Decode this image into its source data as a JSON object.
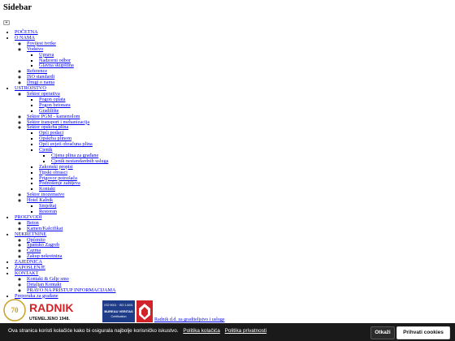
{
  "sidebar": {
    "title": "Sidebar",
    "toggle": "+"
  },
  "nav": {
    "pocetna": "POČETNA",
    "o_nama": {
      "label": "O NAMA",
      "povijest": "Povijest tvrtke",
      "vodstvo": "Vodstvo",
      "uprava": "Uprava",
      "nadzorni": "Nadzorni odbor",
      "glavna": "Glavna skupština",
      "reference": "Reference",
      "iso": "ISO standardi",
      "drugi": "Drugi o nama"
    },
    "ustrojstvo": {
      "label": "USTROJSTVO",
      "operativa": "Sektor operativa",
      "pogon_oplata": "Pogon oplata",
      "pogon_betonara": "Pogon betonara",
      "gradiliste": "Gradilište",
      "pgm": "Sektor PGM - kamenolom",
      "transport": "Sektor transport i mehanizacija",
      "opskrba": "Sektor opskrba plina",
      "opci_podaci": "Opći podaci",
      "opskrba_plinom": "Opskrba plinom",
      "opci_uvjeti": "Opći uvjeti obračuna plina",
      "cjenik": "Cjenik",
      "cijena_plina": "Cijena plina za građane",
      "cjenik_usluga": "Cjenik nestandardnih usluga",
      "zakonski": "Zakonski propisi",
      "tipski": "Tipski obrasci",
      "prigovor": "Prigovor potrošača",
      "podnosenje": "Podnošenje zahtjeva",
      "kontakt": "Kontakt",
      "inozemstvo": "Sektor inozemstvo",
      "hotel": "Hotel Kalnik",
      "smjestaj": "Smještaj",
      "restoran": "Restoran"
    },
    "proizvodi": {
      "label": "PROIZVODI",
      "beton": "Beton",
      "kamen": "Kamen/Kalcifikat"
    },
    "nekretnine": {
      "label": "NEKRETNINE",
      "openito": "Općenito",
      "spansko": "Špansko Zagreb",
      "cazma": "Čazma",
      "zakup": "Zakup nekretnina"
    },
    "zajednica": "ZAJEDNICA",
    "zaposlenje": "ZAPOSLENJE",
    "kontakt": {
      "label": "KONTAKT",
      "kontakt_gdje": "Kontakt & Gdje smo",
      "detaljan": "Detaljan Kontakt",
      "pravo": "PRAVO NA PRISTUP INFORMACIJAMA"
    },
    "preporuka": "Preporuka za građane"
  },
  "logos": {
    "radnik_name": "RADNIK",
    "radnik_sub": "UTEMELJENO 1948.",
    "radnik_badge": "70",
    "bv_text": "ISO 9001 · ISO 14001",
    "bv_name": "BUREAU VERITAS",
    "bv_cert": "Certification",
    "tagline": "Radnik d.d. za graditeljstvo i usluge"
  },
  "cookie": {
    "text": "Ova stranica koristi kolačiće kako bi osigurala najbolje korisničko iskustvo.",
    "policy_link": "Politika kolačića",
    "privacy_link": "Politika privatnosti",
    "decline": "Otkaži",
    "accept": "Prihvati cookies"
  },
  "colors": {
    "link": "#0000ee",
    "cookie_bar": "#1a1a1a",
    "radnik_red": "#d2232a",
    "bv_blue": "#1f3c88"
  }
}
